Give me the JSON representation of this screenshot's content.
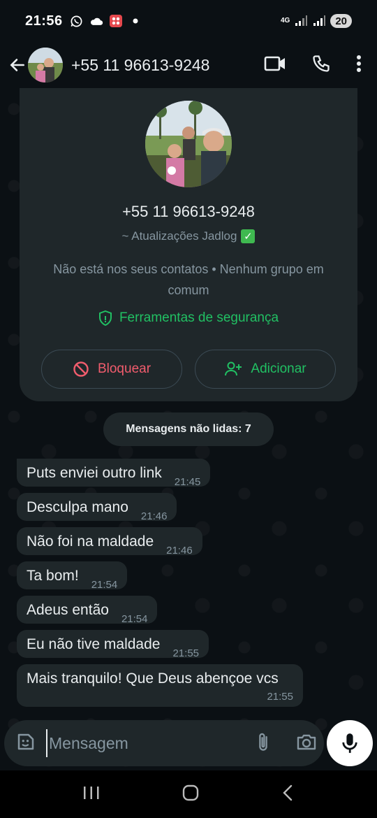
{
  "status_bar": {
    "time": "21:56",
    "network": "4G",
    "battery": "20"
  },
  "header": {
    "title": "+55 11 96613-9248",
    "icons": [
      "back-arrow-icon",
      "video-call-icon",
      "phone-icon",
      "more-options-icon"
    ]
  },
  "contact_card": {
    "phone": "+55 11 96613-9248",
    "subtitle": "~ Atualizações Jadlog",
    "note": "Não está nos seus contatos • Nenhum grupo em comum",
    "security_label": "Ferramentas de segurança",
    "block_label": "Bloquear",
    "add_label": "Adicionar"
  },
  "unread_label": "Mensagens não lidas: 7",
  "messages": [
    {
      "text": "Puts enviei outro link",
      "time": "21:45"
    },
    {
      "text": "Desculpa mano",
      "time": "21:46"
    },
    {
      "text": "Não foi na maldade",
      "time": "21:46"
    },
    {
      "text": "Ta bom!",
      "time": "21:54"
    },
    {
      "text": "Adeus então",
      "time": "21:54"
    },
    {
      "text": "Eu não tive maldade",
      "time": "21:55"
    },
    {
      "text": "Mais tranquilo! Que Deus abençoe vcs",
      "time": "21:55"
    }
  ],
  "composer": {
    "placeholder": "Mensagem"
  },
  "colors": {
    "background": "#0b1014",
    "bubble": "#1f272a",
    "accent_green": "#21c063",
    "danger_red": "#f15c6d"
  }
}
